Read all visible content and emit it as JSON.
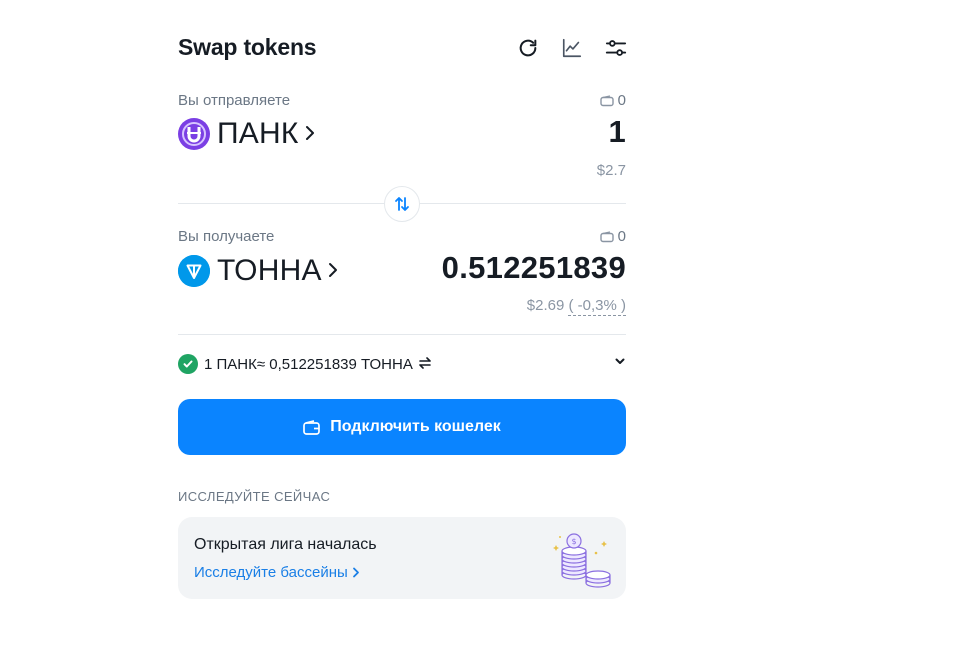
{
  "header": {
    "title": "Swap tokens",
    "icons": [
      "refresh-icon",
      "chart-icon",
      "settings-sliders-icon"
    ]
  },
  "send": {
    "label": "Вы отправляете",
    "balance": "0",
    "token": "ПАНК",
    "amount": "1",
    "usd": "$2.7"
  },
  "receive": {
    "label": "Вы получаете",
    "balance": "0",
    "token": "ТОННА",
    "amount": "0.512251839",
    "usd": "$2.69",
    "impact": "( -0,3% )"
  },
  "rate": {
    "text": "1 ПАНК≈ 0,512251839 ТОННА"
  },
  "connect": {
    "label": "Подключить кошелек"
  },
  "explore": {
    "heading": "ИССЛЕДУЙТЕ СЕЙЧАС",
    "card_title": "Открытая лига началась",
    "card_link": "Исследуйте бассейны"
  },
  "colors": {
    "accent": "#0a84ff",
    "success": "#1fa463",
    "link": "#1a7fe6",
    "punk": "#7b3fe4",
    "ton": "#0098ea"
  }
}
